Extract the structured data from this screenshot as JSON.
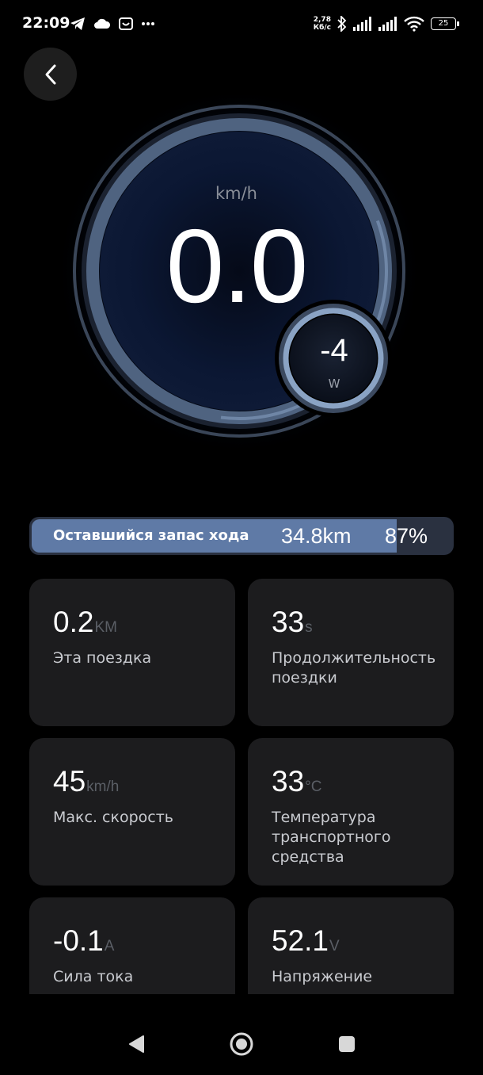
{
  "status_bar": {
    "time": "22:09",
    "net_speed_value": "2,78",
    "net_speed_unit": "Кб/с",
    "battery": "25",
    "icons_left": [
      "telegram-icon",
      "cloud-icon",
      "app-icon",
      "more-dots-icon"
    ],
    "icons_right": [
      "bluetooth-icon",
      "signal-icon",
      "signal-icon",
      "wifi-icon",
      "battery-icon"
    ]
  },
  "gauge": {
    "unit": "km/h",
    "speed": "0.0",
    "power_value": "-4",
    "power_unit": "W"
  },
  "range": {
    "label": "Оставшийся запас хода",
    "distance": "34.8km",
    "percent_text": "87%",
    "percent": 87
  },
  "stats": [
    {
      "value": "0.2",
      "unit": "KM",
      "label": "Эта поездка"
    },
    {
      "value": "33",
      "unit": "s",
      "label": "Продолжительность поездки"
    },
    {
      "value": "45",
      "unit": "km/h",
      "label": "Макс. скорость"
    },
    {
      "value": "33",
      "unit": "°C",
      "label": "Температура транспортного средства"
    },
    {
      "value": "-0.1",
      "unit": "A",
      "label": "Сила тока"
    },
    {
      "value": "52.1",
      "unit": "V",
      "label": "Напряжение"
    }
  ],
  "nav": {
    "icons": [
      "back-triangle-icon",
      "home-circle-icon",
      "recents-square-icon"
    ]
  },
  "colors": {
    "background": "#000000",
    "card": "#1c1c1e",
    "range_fill": "#5f7aa6",
    "range_track": "#2a3140",
    "ring": "#5a6f8f"
  }
}
